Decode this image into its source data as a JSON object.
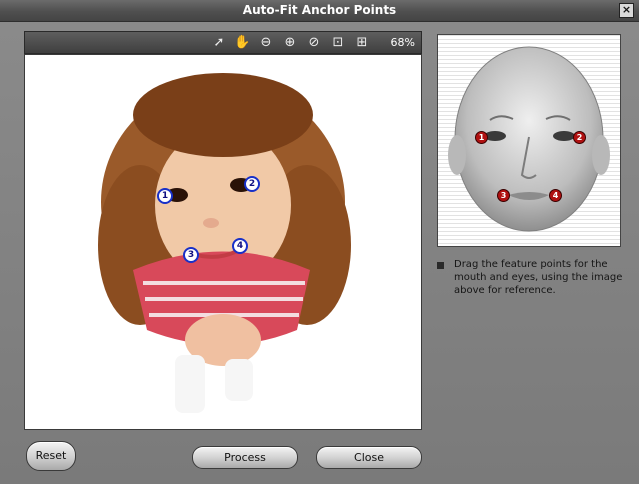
{
  "window": {
    "title": "Auto-Fit Anchor Points",
    "close_glyph": "×"
  },
  "toolbar": {
    "tools": [
      {
        "name": "pointer-tool-icon",
        "glyph": "➚"
      },
      {
        "name": "hand-pan-icon",
        "glyph": "✋"
      },
      {
        "name": "zoom-out-icon",
        "glyph": "⊖"
      },
      {
        "name": "zoom-in-icon",
        "glyph": "⊕"
      },
      {
        "name": "no-zoom-icon",
        "glyph": "⊘"
      },
      {
        "name": "fit-to-window-icon",
        "glyph": "⊡"
      },
      {
        "name": "actual-size-icon",
        "glyph": "⊞"
      }
    ],
    "zoom": "68%"
  },
  "photo_anchors": [
    "1",
    "2",
    "3",
    "4"
  ],
  "reference_anchors": [
    "1",
    "2",
    "3",
    "4"
  ],
  "instructions": "Drag the feature points for the mouth and eyes, using the image above for reference.",
  "buttons": {
    "reset": "Reset",
    "process": "Process",
    "close": "Close"
  },
  "colors": {
    "anchor_border": "#1830c8",
    "reference_dot": "#b01010",
    "titlebar": "#505050"
  }
}
